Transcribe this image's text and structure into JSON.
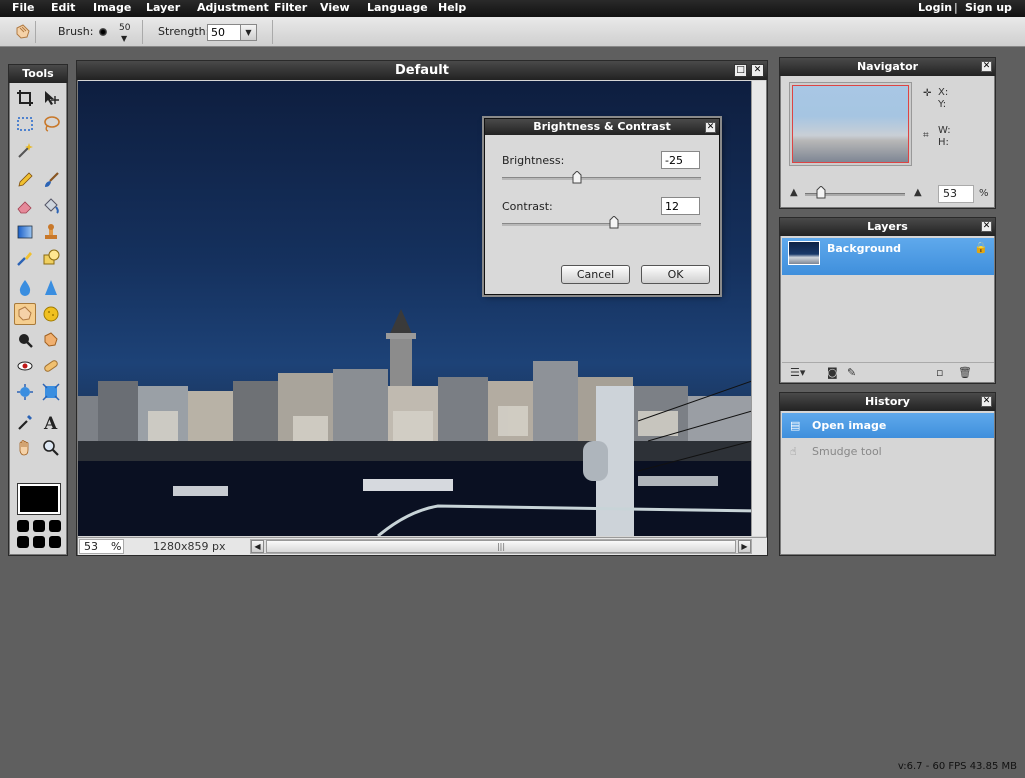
{
  "menu": {
    "items": [
      "File",
      "Edit",
      "Image",
      "Layer",
      "Adjustment",
      "Filter",
      "View",
      "Language",
      "Help"
    ],
    "login": "Login",
    "separator": "|",
    "signup": "Sign up"
  },
  "options": {
    "brush_label": "Brush:",
    "brush_size": "50",
    "strength_label": "Strength:",
    "strength_value": "50"
  },
  "tools": {
    "title": "Tools",
    "active_tool": "smudge-tool",
    "foreground_color": "#000000"
  },
  "document": {
    "title": "Default",
    "zoom": "53",
    "zoom_unit": "%",
    "dimensions": "1280x859 px"
  },
  "dialog": {
    "title": "Brightness & Contrast",
    "brightness_label": "Brightness:",
    "brightness_value": "-25",
    "contrast_label": "Contrast:",
    "contrast_value": "12",
    "cancel_label": "Cancel",
    "ok_label": "OK"
  },
  "navigator": {
    "title": "Navigator",
    "x_label": "X:",
    "y_label": "Y:",
    "w_label": "W:",
    "h_label": "H:",
    "zoom_value": "53",
    "zoom_unit": "%"
  },
  "layers": {
    "title": "Layers",
    "items": [
      {
        "name": "Background",
        "locked": true
      }
    ]
  },
  "history": {
    "title": "History",
    "items": [
      {
        "label": "Open image",
        "icon": "document-icon"
      },
      {
        "label": "Smudge tool",
        "icon": "smudge-icon"
      }
    ]
  },
  "status": {
    "version": "v:6.7 - 60 FPS 43.85 MB"
  },
  "colors": {
    "selection_blue": "#4a9be6",
    "panel_title": "#2e2e2e",
    "workspace": "#5f5f5f"
  }
}
